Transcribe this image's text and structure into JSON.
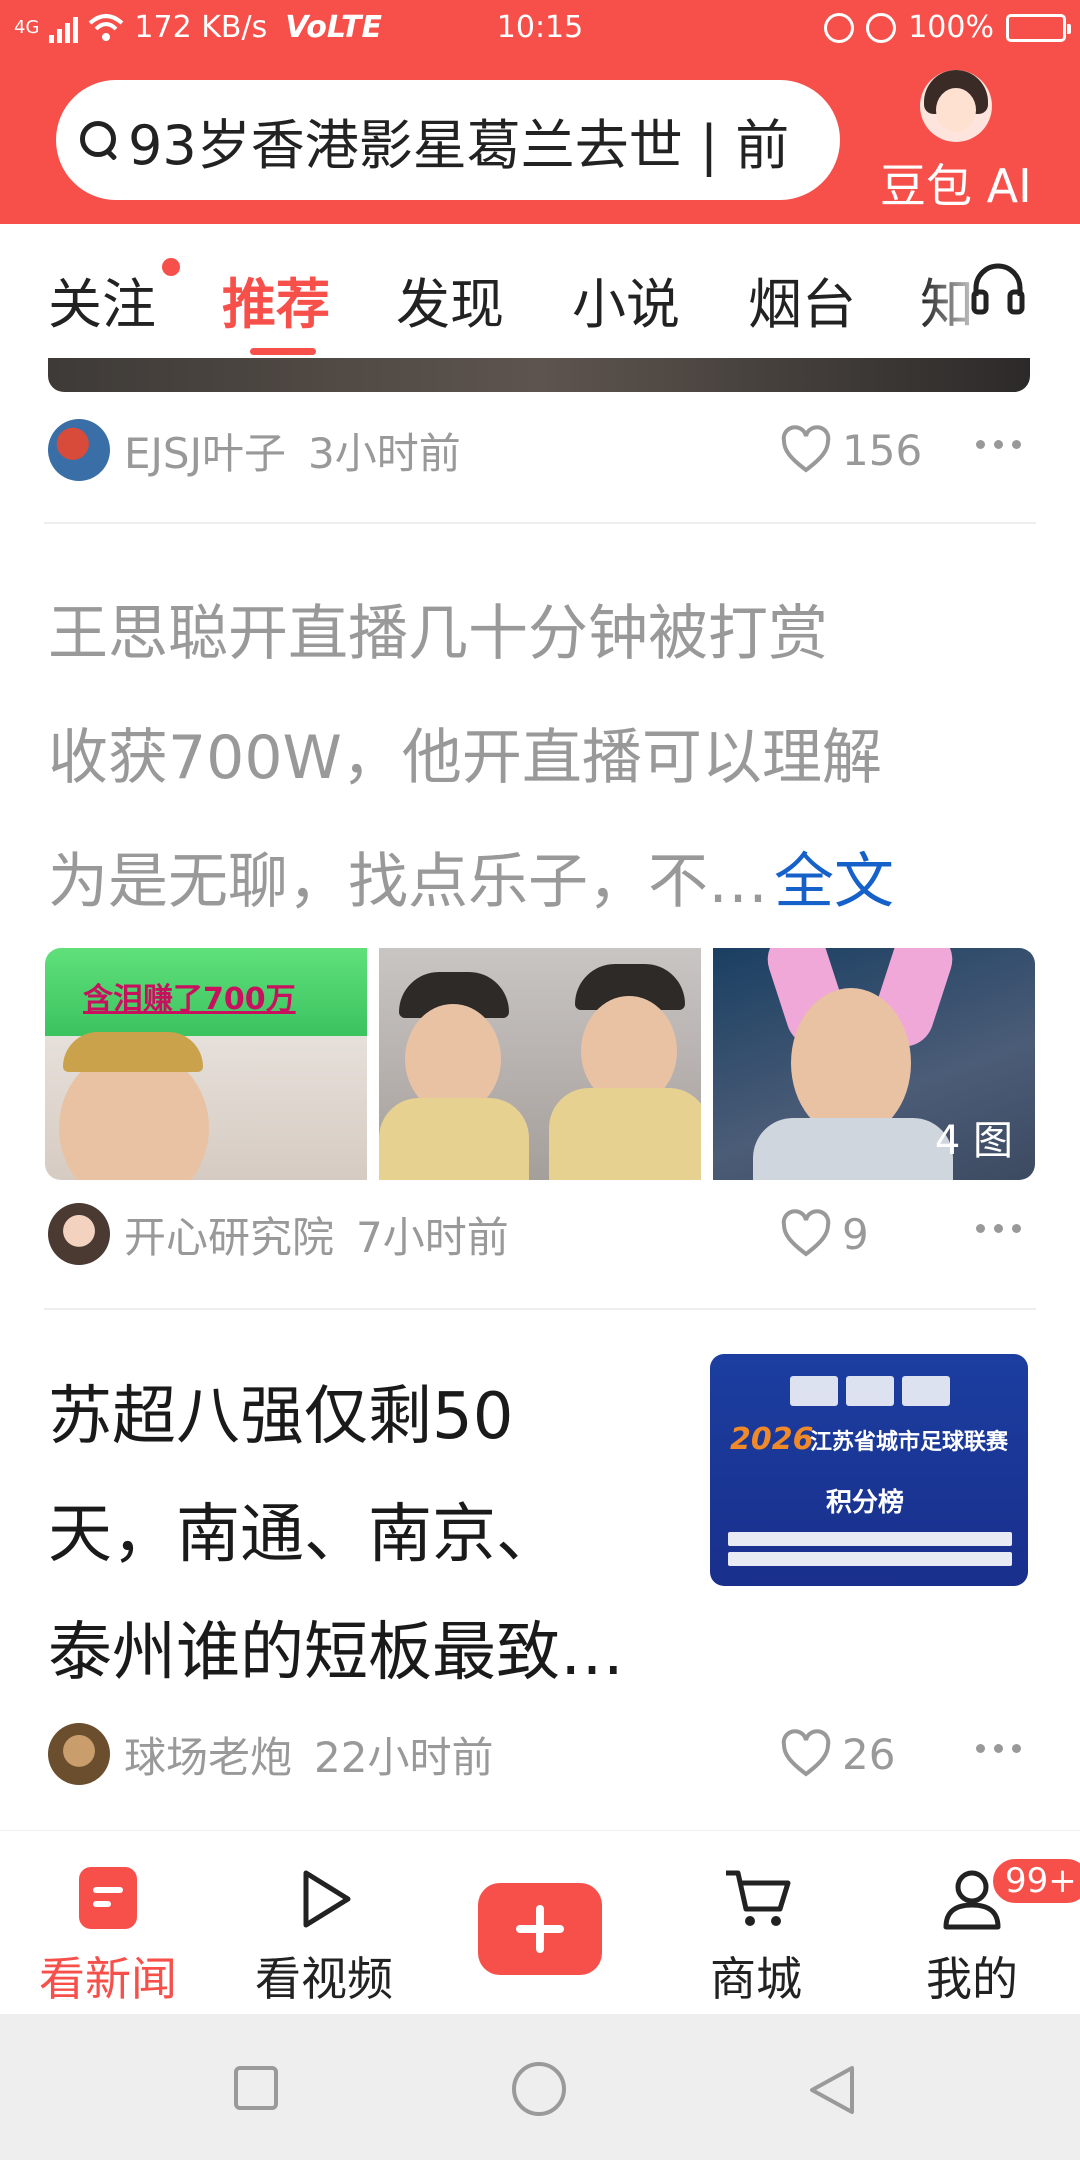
{
  "status_bar": {
    "network": "4G",
    "speed": "172 KB/s",
    "volte": "VoLTE",
    "time": "10:15",
    "battery": "100%"
  },
  "search": {
    "query": "93岁香港影星葛兰去世 | 前"
  },
  "ai_assistant": {
    "label": "豆包 AI"
  },
  "tabs": [
    "关注",
    "推荐",
    "发现",
    "小说",
    "烟台",
    "知"
  ],
  "active_tab": "推荐",
  "feed": [
    {
      "source": "EJSJ叶子",
      "time": "3小时前",
      "likes": "156"
    },
    {
      "text_lines": [
        "王思聪开直播几十分钟被打赏",
        "收获700W，他开直播可以理解",
        "为是无聊，找点乐子，不…"
      ],
      "more_label": "全文",
      "thumb_banner": "含泪赚了700万",
      "image_count": "4 图",
      "source": "开心研究院",
      "time": "7小时前",
      "likes": "9"
    },
    {
      "title_lines": [
        "苏超八强仅剩50",
        "天，南通、南京、",
        "泰州谁的短板最致…"
      ],
      "card": {
        "year": "2026",
        "title": "江苏省城市足球联赛",
        "subtitle": "积分榜"
      },
      "source": "球场老炮",
      "time": "22小时前",
      "likes": "26"
    }
  ],
  "bottom_nav": [
    {
      "label": "看新闻",
      "icon": "news-icon",
      "active": true
    },
    {
      "label": "看视频",
      "icon": "play-icon",
      "active": false
    },
    {
      "label": "",
      "icon": "plus-icon",
      "active": false
    },
    {
      "label": "商城",
      "icon": "cart-icon",
      "active": false
    },
    {
      "label": "我的",
      "icon": "user-icon",
      "active": false
    }
  ],
  "badge": "99+",
  "colors": {
    "brand": "#f7504b",
    "link": "#1560c9",
    "muted": "#999999"
  }
}
